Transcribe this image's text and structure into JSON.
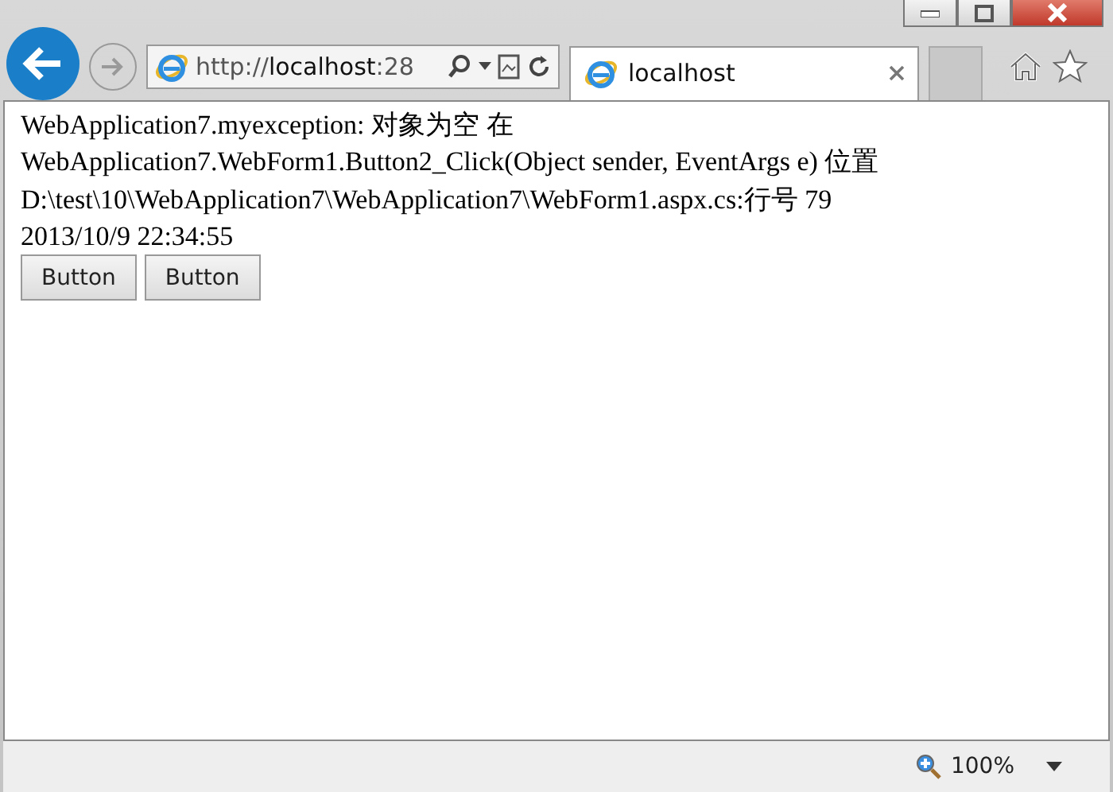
{
  "address_bar": {
    "url": "http://**localhost**:28"
  },
  "tabs": [
    {
      "label": "localhost",
      "selected": true
    }
  ],
  "content": {
    "lines": [
      "WebApplication7.myexception: 对象为空 在",
      "WebApplication7.WebForm1.Button2_Click(Object sender, EventArgs e) 位置",
      "D:\\test\\10\\WebApplication7\\WebApplication7\\WebForm1.aspx.cs:行号 79",
      "2013/10/9 22:34:55"
    ],
    "buttons": [
      "Button",
      "Button"
    ]
  },
  "status_bar": {
    "zoom": "100%"
  }
}
